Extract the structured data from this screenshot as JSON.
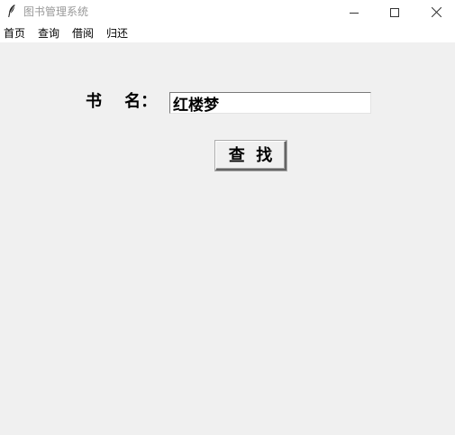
{
  "window": {
    "title": "图书管理系统",
    "icons": {
      "app": "feather-icon",
      "minimize": "minimize-icon",
      "maximize": "maximize-icon",
      "close": "close-icon"
    }
  },
  "menubar": {
    "items": [
      {
        "label": "首页"
      },
      {
        "label": "查询"
      },
      {
        "label": "借阅"
      },
      {
        "label": "归还"
      }
    ]
  },
  "form": {
    "book_name_label": "书    名：",
    "book_name_value": "红楼梦",
    "search_button_label": "查  找"
  }
}
